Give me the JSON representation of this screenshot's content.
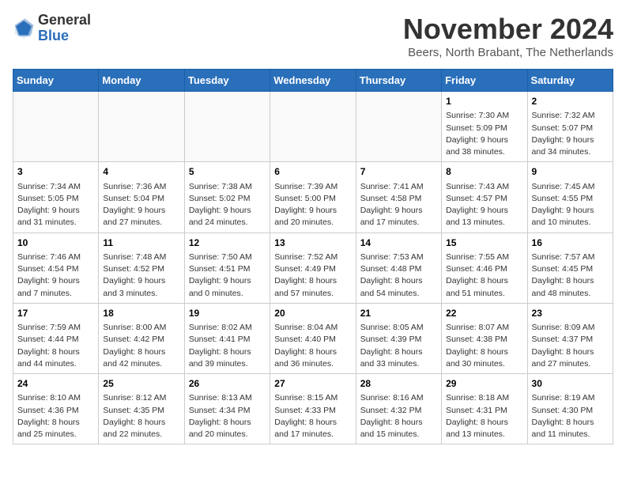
{
  "logo": {
    "general": "General",
    "blue": "Blue"
  },
  "title": "November 2024",
  "subtitle": "Beers, North Brabant, The Netherlands",
  "headers": [
    "Sunday",
    "Monday",
    "Tuesday",
    "Wednesday",
    "Thursday",
    "Friday",
    "Saturday"
  ],
  "weeks": [
    [
      {
        "day": "",
        "info": ""
      },
      {
        "day": "",
        "info": ""
      },
      {
        "day": "",
        "info": ""
      },
      {
        "day": "",
        "info": ""
      },
      {
        "day": "",
        "info": ""
      },
      {
        "day": "1",
        "info": "Sunrise: 7:30 AM\nSunset: 5:09 PM\nDaylight: 9 hours and 38 minutes."
      },
      {
        "day": "2",
        "info": "Sunrise: 7:32 AM\nSunset: 5:07 PM\nDaylight: 9 hours and 34 minutes."
      }
    ],
    [
      {
        "day": "3",
        "info": "Sunrise: 7:34 AM\nSunset: 5:05 PM\nDaylight: 9 hours and 31 minutes."
      },
      {
        "day": "4",
        "info": "Sunrise: 7:36 AM\nSunset: 5:04 PM\nDaylight: 9 hours and 27 minutes."
      },
      {
        "day": "5",
        "info": "Sunrise: 7:38 AM\nSunset: 5:02 PM\nDaylight: 9 hours and 24 minutes."
      },
      {
        "day": "6",
        "info": "Sunrise: 7:39 AM\nSunset: 5:00 PM\nDaylight: 9 hours and 20 minutes."
      },
      {
        "day": "7",
        "info": "Sunrise: 7:41 AM\nSunset: 4:58 PM\nDaylight: 9 hours and 17 minutes."
      },
      {
        "day": "8",
        "info": "Sunrise: 7:43 AM\nSunset: 4:57 PM\nDaylight: 9 hours and 13 minutes."
      },
      {
        "day": "9",
        "info": "Sunrise: 7:45 AM\nSunset: 4:55 PM\nDaylight: 9 hours and 10 minutes."
      }
    ],
    [
      {
        "day": "10",
        "info": "Sunrise: 7:46 AM\nSunset: 4:54 PM\nDaylight: 9 hours and 7 minutes."
      },
      {
        "day": "11",
        "info": "Sunrise: 7:48 AM\nSunset: 4:52 PM\nDaylight: 9 hours and 3 minutes."
      },
      {
        "day": "12",
        "info": "Sunrise: 7:50 AM\nSunset: 4:51 PM\nDaylight: 9 hours and 0 minutes."
      },
      {
        "day": "13",
        "info": "Sunrise: 7:52 AM\nSunset: 4:49 PM\nDaylight: 8 hours and 57 minutes."
      },
      {
        "day": "14",
        "info": "Sunrise: 7:53 AM\nSunset: 4:48 PM\nDaylight: 8 hours and 54 minutes."
      },
      {
        "day": "15",
        "info": "Sunrise: 7:55 AM\nSunset: 4:46 PM\nDaylight: 8 hours and 51 minutes."
      },
      {
        "day": "16",
        "info": "Sunrise: 7:57 AM\nSunset: 4:45 PM\nDaylight: 8 hours and 48 minutes."
      }
    ],
    [
      {
        "day": "17",
        "info": "Sunrise: 7:59 AM\nSunset: 4:44 PM\nDaylight: 8 hours and 44 minutes."
      },
      {
        "day": "18",
        "info": "Sunrise: 8:00 AM\nSunset: 4:42 PM\nDaylight: 8 hours and 42 minutes."
      },
      {
        "day": "19",
        "info": "Sunrise: 8:02 AM\nSunset: 4:41 PM\nDaylight: 8 hours and 39 minutes."
      },
      {
        "day": "20",
        "info": "Sunrise: 8:04 AM\nSunset: 4:40 PM\nDaylight: 8 hours and 36 minutes."
      },
      {
        "day": "21",
        "info": "Sunrise: 8:05 AM\nSunset: 4:39 PM\nDaylight: 8 hours and 33 minutes."
      },
      {
        "day": "22",
        "info": "Sunrise: 8:07 AM\nSunset: 4:38 PM\nDaylight: 8 hours and 30 minutes."
      },
      {
        "day": "23",
        "info": "Sunrise: 8:09 AM\nSunset: 4:37 PM\nDaylight: 8 hours and 27 minutes."
      }
    ],
    [
      {
        "day": "24",
        "info": "Sunrise: 8:10 AM\nSunset: 4:36 PM\nDaylight: 8 hours and 25 minutes."
      },
      {
        "day": "25",
        "info": "Sunrise: 8:12 AM\nSunset: 4:35 PM\nDaylight: 8 hours and 22 minutes."
      },
      {
        "day": "26",
        "info": "Sunrise: 8:13 AM\nSunset: 4:34 PM\nDaylight: 8 hours and 20 minutes."
      },
      {
        "day": "27",
        "info": "Sunrise: 8:15 AM\nSunset: 4:33 PM\nDaylight: 8 hours and 17 minutes."
      },
      {
        "day": "28",
        "info": "Sunrise: 8:16 AM\nSunset: 4:32 PM\nDaylight: 8 hours and 15 minutes."
      },
      {
        "day": "29",
        "info": "Sunrise: 8:18 AM\nSunset: 4:31 PM\nDaylight: 8 hours and 13 minutes."
      },
      {
        "day": "30",
        "info": "Sunrise: 8:19 AM\nSunset: 4:30 PM\nDaylight: 8 hours and 11 minutes."
      }
    ]
  ]
}
